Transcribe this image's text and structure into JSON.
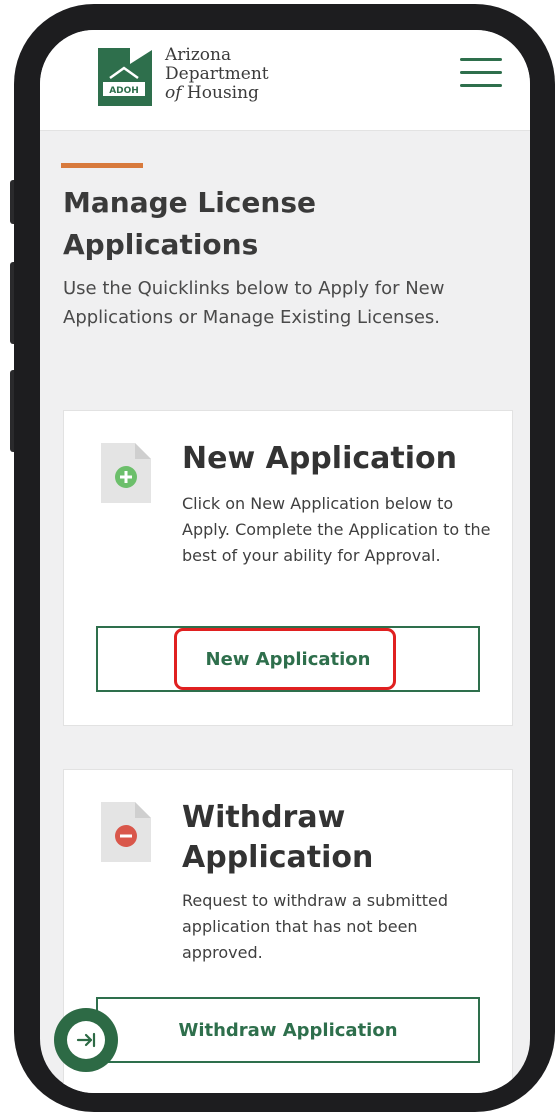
{
  "header": {
    "org_line1": "Arizona",
    "org_line2": "Department",
    "org_line3_italic": "of",
    "org_line3": " Housing",
    "logo_badge": "ADOH",
    "menu_icon": "hamburger-menu-icon"
  },
  "page": {
    "title": "Manage License Applications",
    "description": "Use the Quicklinks below to Apply for New Applications or Manage Existing Licenses."
  },
  "cards": [
    {
      "icon": "document-add-icon",
      "title": "New Application",
      "description": "Click on New Application below to Apply. Complete the Application to the best of your ability for Approval.",
      "button_label": "New Application"
    },
    {
      "icon": "document-remove-icon",
      "title": "Withdraw Application",
      "description": "Request to withdraw a submitted application that has not been approved.",
      "button_label": "Withdraw Application"
    }
  ],
  "floating_button": {
    "icon": "arrow-to-right-icon"
  },
  "colors": {
    "brand_green": "#2e6f4c",
    "accent_orange": "#d87a3c",
    "highlight_red": "#e02020",
    "add_green": "#6cbf6b",
    "remove_red": "#d9574b"
  }
}
